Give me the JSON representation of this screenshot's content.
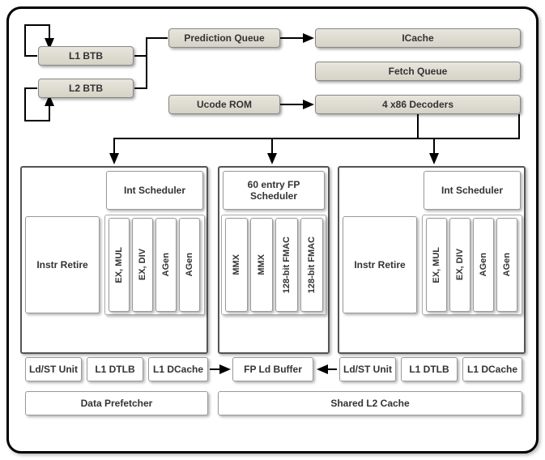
{
  "frontend": {
    "l1btb": "L1 BTB",
    "l2btb": "L2 BTB",
    "predq": "Prediction Queue",
    "ucode": "Ucode ROM",
    "icache": "ICache",
    "fetchq": "Fetch Queue",
    "decoders": "4 x86 Decoders"
  },
  "core": {
    "intsched_l": "Int Scheduler",
    "intsched_r": "Int Scheduler",
    "fpsched": "60 entry FP Scheduler",
    "retire_l": "Instr Retire",
    "retire_r": "Instr Retire",
    "exec": {
      "exmul": "EX, MUL",
      "exdiv": "EX, DIV",
      "agen": "AGen",
      "mmx": "MMX",
      "fmac": "128-bit FMAC"
    },
    "ldst": "Ld/ST Unit",
    "dtlb": "L1 DTLB",
    "dcache": "L1 DCache",
    "fpldbuf": "FP Ld Buffer"
  },
  "bottom": {
    "prefetch": "Data Prefetcher",
    "l2": "Shared L2 Cache"
  }
}
